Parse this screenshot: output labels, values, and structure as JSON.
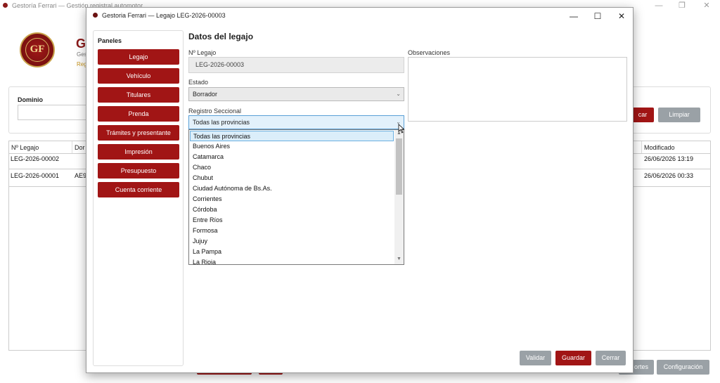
{
  "main_window": {
    "title": "Gestoría Ferrari — Gestión registral automotor",
    "controls": {
      "minimize": "—",
      "maximize": "❐",
      "close": "✕"
    },
    "logo_text": "GF",
    "app_title_fragment": "G",
    "app_sub_fragment": "Ges",
    "app_sub2_fragment": "Reg",
    "filter": {
      "dominio_label": "Dominio",
      "search_fragment": "car",
      "clear_label": "Limpiar"
    },
    "table": {
      "headers": {
        "legajo": "Nº Legajo",
        "dominio_fragment": "Dor",
        "modificado": "Modificado"
      },
      "rows": [
        {
          "legajo": "LEG-2026-00002",
          "dominio": "",
          "modificado": "26/06/2026 13:19"
        },
        {
          "legajo": "LEG-2026-00001",
          "dominio": "AE9(",
          "modificado": "26/06/2026 00:33"
        }
      ]
    },
    "bottom": {
      "reportes_fragment": "ortes",
      "configuracion": "Configuración"
    }
  },
  "dialog": {
    "title": "Gestoria Ferrari — Legajo LEG-2026-00003",
    "controls": {
      "minimize": "—",
      "maximize": "☐",
      "close": "✕"
    },
    "paneles": {
      "title": "Paneles",
      "items": [
        "Legajo",
        "Vehículo",
        "Titulares",
        "Prenda",
        "Trámites y presentante",
        "Impresión",
        "Presupuesto",
        "Cuenta corriente"
      ]
    },
    "section_title": "Datos del legajo",
    "fields": {
      "legajo_label": "Nº Legajo",
      "legajo_value": "LEG-2026-00003",
      "estado_label": "Estado",
      "estado_value": "Borrador",
      "registro_label": "Registro Seccional",
      "registro_value": "Todas las provincias",
      "observaciones_label": "Observaciones"
    },
    "dropdown_options": [
      "Todas las provincias",
      "Buenos Aires",
      "Catamarca",
      "Chaco",
      "Chubut",
      "Ciudad Autónoma de Bs.As.",
      "Corrientes",
      "Córdoba",
      "Entre Ríos",
      "Formosa",
      "Jujuy",
      "La Pampa",
      "La Rioja"
    ],
    "buttons": {
      "validar": "Validar",
      "guardar": "Guardar",
      "cerrar": "Cerrar"
    }
  },
  "colors": {
    "brand_red": "#a11515",
    "grey_button": "#9aa1a6",
    "gold": "#c9a24a"
  }
}
